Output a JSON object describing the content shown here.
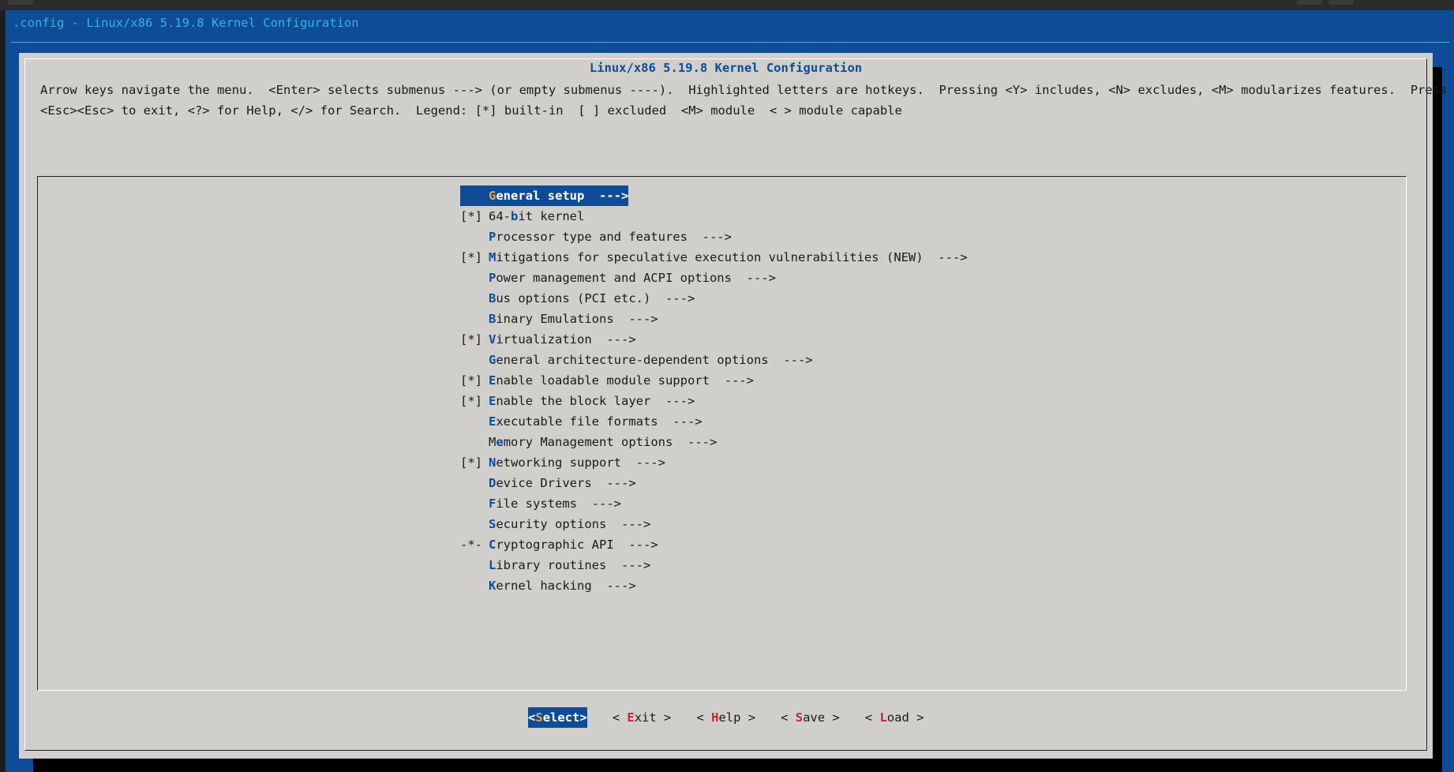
{
  "backtitle": ".config - Linux/x86 5.19.8 Kernel Configuration",
  "dialog": {
    "title": "Linux/x86 5.19.8 Kernel Configuration",
    "help_line1": "Arrow keys navigate the menu.  <Enter> selects submenus ---> (or empty submenus ----).  Highlighted letters are hotkeys.  Pressing <Y> includes, <N> excludes, <M> modularizes features.  Press",
    "help_line2": "<Esc><Esc> to exit, <?> for Help, </> for Search.  Legend: [*] built-in  [ ] excluded  <M> module  < > module capable"
  },
  "menu": {
    "items": [
      {
        "prefix": "",
        "hk": "G",
        "rest": "eneral setup  --->",
        "pre": "",
        "selected": true
      },
      {
        "prefix": "[*]",
        "pre": "64-",
        "hk": "b",
        "rest": "it kernel"
      },
      {
        "prefix": "",
        "pre": "",
        "hk": "P",
        "rest": "rocessor type and features  --->"
      },
      {
        "prefix": "[*]",
        "pre": "",
        "hk": "M",
        "rest": "itigations for speculative execution vulnerabilities (NEW)  --->"
      },
      {
        "prefix": "",
        "pre": "",
        "hk": "P",
        "rest": "ower management and ACPI options  --->"
      },
      {
        "prefix": "",
        "pre": "",
        "hk": "B",
        "rest": "us options (PCI etc.)  --->"
      },
      {
        "prefix": "",
        "pre": "",
        "hk": "B",
        "rest": "inary Emulations  --->"
      },
      {
        "prefix": "[*]",
        "pre": "",
        "hk": "V",
        "rest": "irtualization  --->"
      },
      {
        "prefix": "",
        "pre": "",
        "hk": "G",
        "rest": "eneral architecture-dependent options  --->"
      },
      {
        "prefix": "[*]",
        "pre": "",
        "hk": "E",
        "rest": "nable loadable module support  --->"
      },
      {
        "prefix": "[*]",
        "pre": "",
        "hk": "E",
        "rest": "nable the block layer  --->"
      },
      {
        "prefix": "",
        "pre": "",
        "hk": "E",
        "rest": "xecutable file formats  --->"
      },
      {
        "prefix": "",
        "pre": "M",
        "hk": "e",
        "rest": "mory Management options  --->"
      },
      {
        "prefix": "[*]",
        "pre": "",
        "hk": "N",
        "rest": "etworking support  --->"
      },
      {
        "prefix": "",
        "pre": "",
        "hk": "D",
        "rest": "evice Drivers  --->"
      },
      {
        "prefix": "",
        "pre": "",
        "hk": "F",
        "rest": "ile systems  --->"
      },
      {
        "prefix": "",
        "pre": "",
        "hk": "S",
        "rest": "ecurity options  --->"
      },
      {
        "prefix": "-*-",
        "pre": "",
        "hk": "C",
        "rest": "ryptographic API  --->"
      },
      {
        "prefix": "",
        "pre": "",
        "hk": "L",
        "rest": "ibrary routines  --->"
      },
      {
        "prefix": "",
        "pre": "",
        "hk": "K",
        "rest": "ernel hacking  --->"
      }
    ]
  },
  "buttons": [
    {
      "open": "<",
      "hk": "S",
      "rest": "elect",
      "close": ">",
      "active": true
    },
    {
      "open": "< ",
      "hk": "E",
      "rest": "xit",
      "close": " >"
    },
    {
      "open": "< ",
      "hk": "H",
      "rest": "elp",
      "close": " >"
    },
    {
      "open": "< ",
      "hk": "S",
      "rest": "ave",
      "close": " >"
    },
    {
      "open": "< ",
      "hk": "L",
      "rest": "oad",
      "close": " >"
    }
  ],
  "colors": {
    "background_blue": "#0f4c97",
    "dialog_gray": "#d0cfcc",
    "hotkey_blue": "#0f4c97",
    "button_hotkey_red": "#c4262e",
    "selected_hotkey": "#e5a34b"
  }
}
